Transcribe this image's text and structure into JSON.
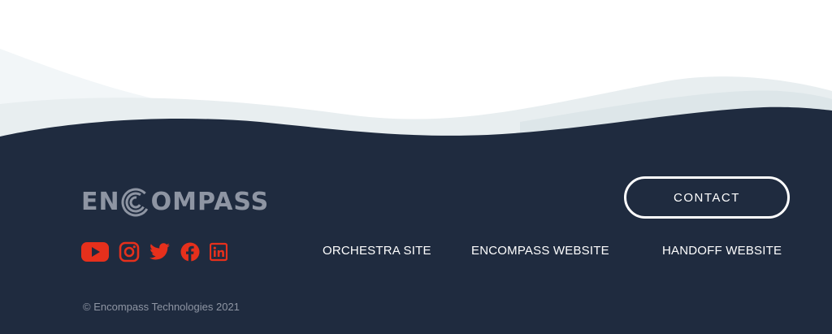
{
  "colors": {
    "footer_bg": "#1f2b3f",
    "wave_light": "#e8eef0",
    "wave_faint": "#f2f6f8",
    "logo_grey": "#8e95a3",
    "social_red": "#e6301c",
    "text_white": "#ffffff"
  },
  "logo": {
    "text_left": "EN",
    "text_right": "OMPASS",
    "mark_icon": "encompass-c-logo-icon"
  },
  "contact_button": {
    "label": "CONTACT"
  },
  "social_icons": [
    "youtube-icon",
    "instagram-icon",
    "twitter-icon",
    "facebook-icon",
    "linkedin-icon"
  ],
  "nav_links": [
    {
      "label": "ORCHESTRA SITE"
    },
    {
      "label": "ENCOMPASS WEBSITE"
    },
    {
      "label": "HANDOFF WEBSITE"
    }
  ],
  "copyright": "© Encompass Technologies 2021"
}
